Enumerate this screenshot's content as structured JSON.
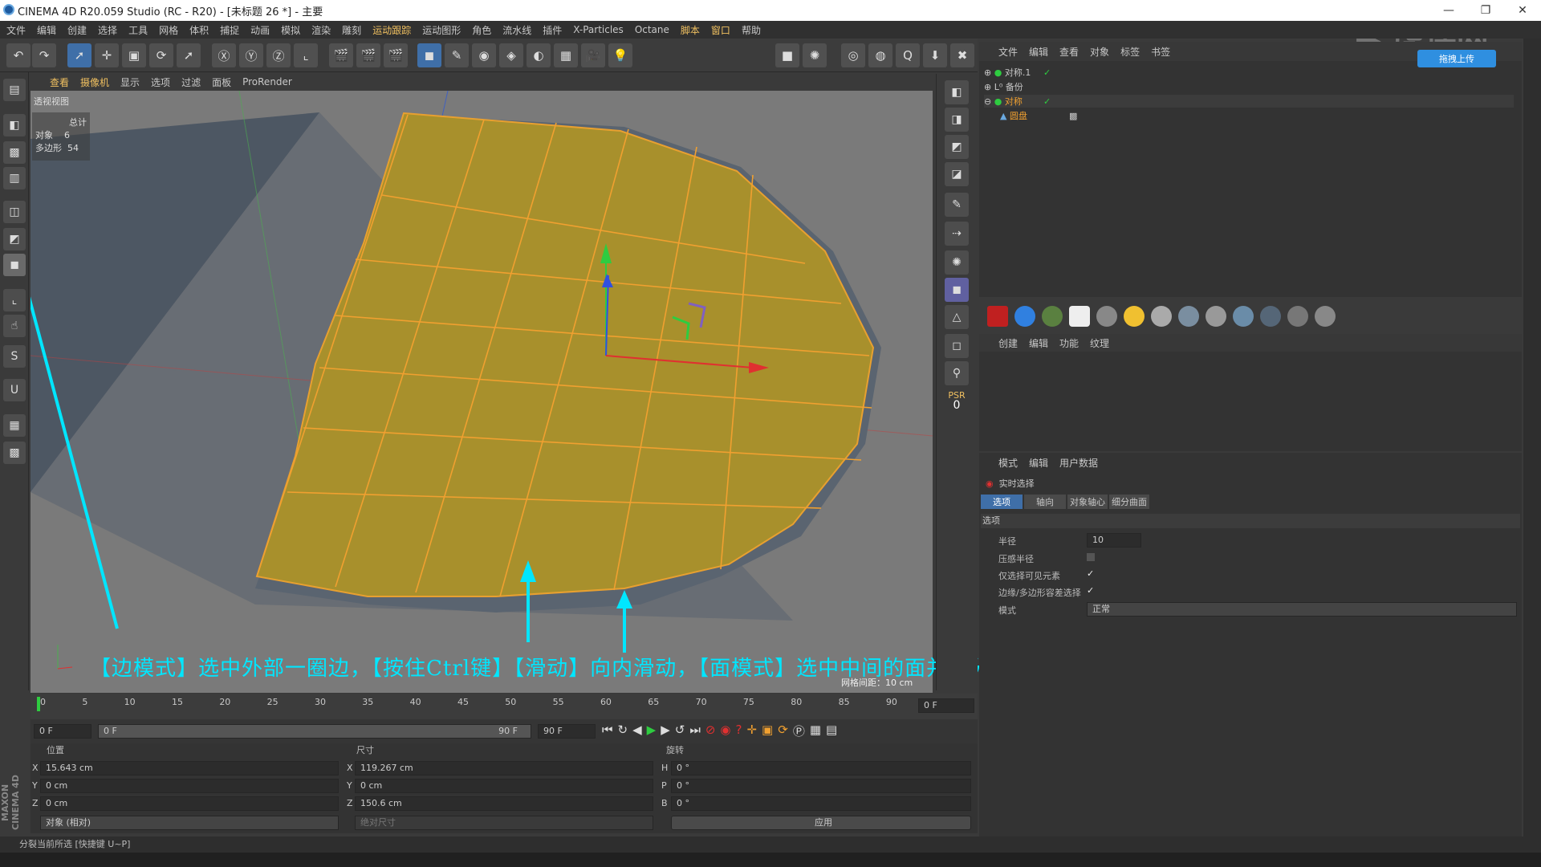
{
  "window": {
    "title": "CINEMA 4D R20.059 Studio (RC - R20) - [未标题 26 *] - 主要"
  },
  "menu": [
    "文件",
    "编辑",
    "创建",
    "选择",
    "工具",
    "网格",
    "体积",
    "捕捉",
    "动画",
    "模拟",
    "渲染",
    "雕刻",
    "运动跟踪",
    "运动图形",
    "角色",
    "流水线",
    "插件",
    "X-Particles",
    "Octane",
    "脚本",
    "窗口",
    "帮助"
  ],
  "viewport": {
    "menu": [
      "查看",
      "摄像机",
      "显示",
      "选项",
      "过滤",
      "面板",
      "ProRender"
    ],
    "label": "透视视图",
    "stats_header": "总计",
    "stats_obj_label": "对象",
    "stats_obj_value": "6",
    "stats_poly_label": "多边形",
    "stats_poly_value": "54",
    "grid_note": "网格间距：10 cm"
  },
  "caption": "【边模式】选中外部一圈边，【按住Ctrl键】【滑动】向内滑动，【面模式】选中中间的面并【分裂】",
  "timeline": {
    "ticks": [
      "0",
      "5",
      "10",
      "15",
      "20",
      "25",
      "30",
      "35",
      "40",
      "45",
      "50",
      "55",
      "60",
      "65",
      "70",
      "75",
      "80",
      "85",
      "90"
    ],
    "frame_end": "0 F"
  },
  "transport": {
    "start": "0 F",
    "range_start": "0 F",
    "range_end": "90 F",
    "end": "90 F"
  },
  "coords": {
    "pos_header": "位置",
    "size_header": "尺寸",
    "rot_header": "旋转",
    "px": "15.643 cm",
    "py": "0 cm",
    "pz": "0 cm",
    "sx": "119.267 cm",
    "sy": "0 cm",
    "sz": "150.6 cm",
    "rh": "0 °",
    "rp": "0 °",
    "rb": "0 °",
    "mode_label": "对象 (相对)",
    "size_mode": "绝对尺寸",
    "apply": "应用"
  },
  "status": "分裂当前所选 [快捷键 U~P]",
  "maxon": "MAXON CINEMA 4D",
  "objmgr": {
    "menu": [
      "文件",
      "编辑",
      "查看",
      "对象",
      "标签",
      "书签"
    ],
    "rows": [
      "对称.1",
      "备份",
      "对称",
      "圆盘"
    ],
    "upload": "拖拽上传"
  },
  "matmgr": {
    "menu": [
      "创建",
      "编辑",
      "功能",
      "纹理"
    ]
  },
  "attr": {
    "menu": [
      "模式",
      "编辑",
      "用户数据"
    ],
    "title": "实时选择",
    "tabs": [
      "选项",
      "轴向",
      "对象轴心",
      "细分曲面"
    ],
    "section": "选项",
    "radius_label": "半径",
    "radius_value": "10",
    "pressure_label": "压感半径",
    "visible_label": "仅选择可见元素",
    "tolerance_label": "边缘/多边形容差选择",
    "mode_label": "模式",
    "mode_value": "正常"
  },
  "psr": {
    "label": "PSR",
    "value": "0"
  }
}
